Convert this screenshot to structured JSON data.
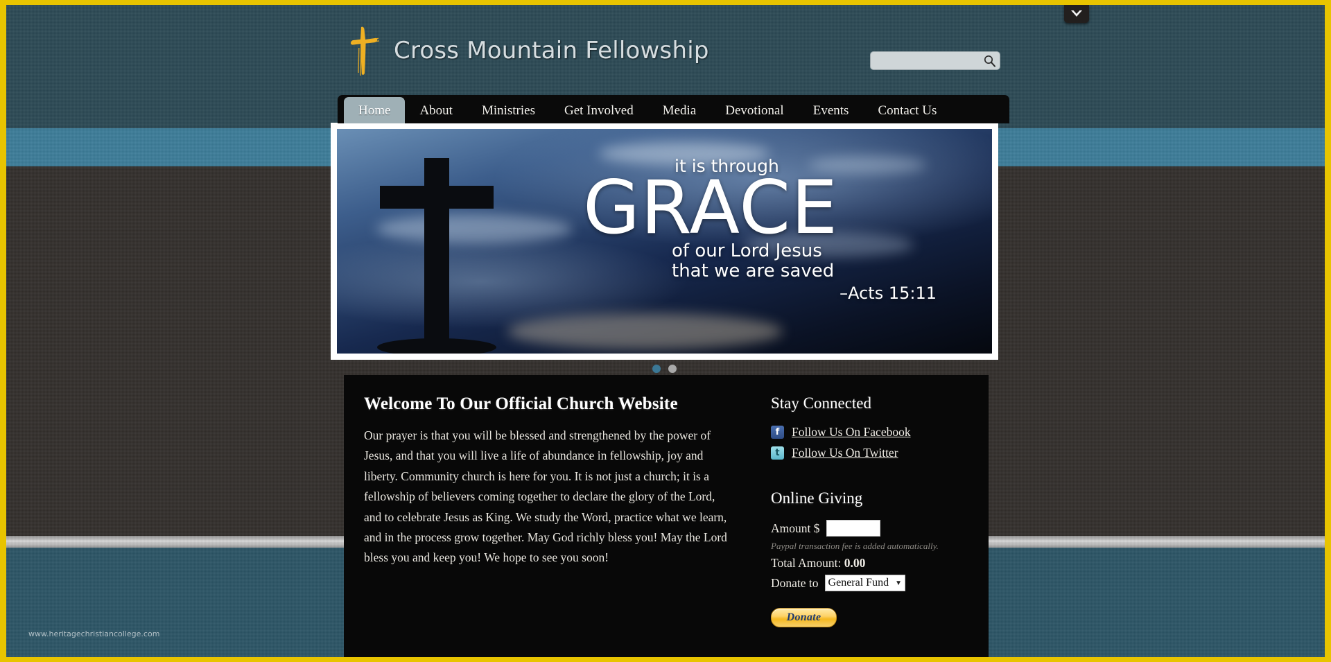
{
  "site": {
    "brand_title": "Cross Mountain Fellowship",
    "brand_mark_icon": "cross-icon",
    "frame_color": "#e8c400",
    "watermark": "www.heritagechristiancollege.com"
  },
  "chevron_widget": {
    "icon": "chevron-down-icon"
  },
  "search": {
    "value": "",
    "placeholder": "",
    "icon": "search-icon"
  },
  "nav": {
    "items": [
      {
        "label": "Home",
        "active": true
      },
      {
        "label": "About",
        "active": false
      },
      {
        "label": "Ministries",
        "active": false
      },
      {
        "label": "Get Involved",
        "active": false
      },
      {
        "label": "Media",
        "active": false
      },
      {
        "label": "Devotional",
        "active": false
      },
      {
        "label": "Events",
        "active": false
      },
      {
        "label": "Contact Us",
        "active": false
      }
    ]
  },
  "slider": {
    "slide": {
      "line1": "it is through",
      "word": "GRACE",
      "line3": "of our Lord Jesus",
      "line4": "that we are saved",
      "reference": "–Acts 15:11",
      "cross_icon": "cross-silhouette-icon"
    },
    "dots": [
      {
        "active": true,
        "color": "#3b7896"
      },
      {
        "active": false,
        "color": "#a9a9a9"
      }
    ]
  },
  "main": {
    "heading": "Welcome To Our Official Church Website",
    "body": "Our prayer is that you will be blessed and strengthened by the power of Jesus, and that you will live a life of abundance in fellowship, joy and liberty. Community church is here for you. It is not just a church; it is a fellowship of believers coming together to declare the glory of the Lord, and to celebrate Jesus as King. We study the Word, practice what we learn, and in the process grow together. May God richly bless you! May the Lord bless you and keep you! We hope to see you soon!"
  },
  "sidebar": {
    "stay_connected": {
      "heading": "Stay Connected",
      "links": [
        {
          "label": "Follow Us On Facebook",
          "icon": "facebook-icon",
          "glyph": "f",
          "color": "#3b5998"
        },
        {
          "label": "Follow Us On Twitter",
          "icon": "twitter-icon",
          "glyph": "t",
          "color": "#76c7da"
        }
      ]
    },
    "online_giving": {
      "heading": "Online Giving",
      "amount_label": "Amount $",
      "amount_value": "",
      "fee_note": "Paypal transaction fee is added automatically.",
      "total_label": "Total Amount:",
      "total_value": "0.00",
      "donate_to_label": "Donate to",
      "fund_selected": "General Fund",
      "fund_caret": "▼",
      "donate_button_label": "Donate"
    }
  }
}
